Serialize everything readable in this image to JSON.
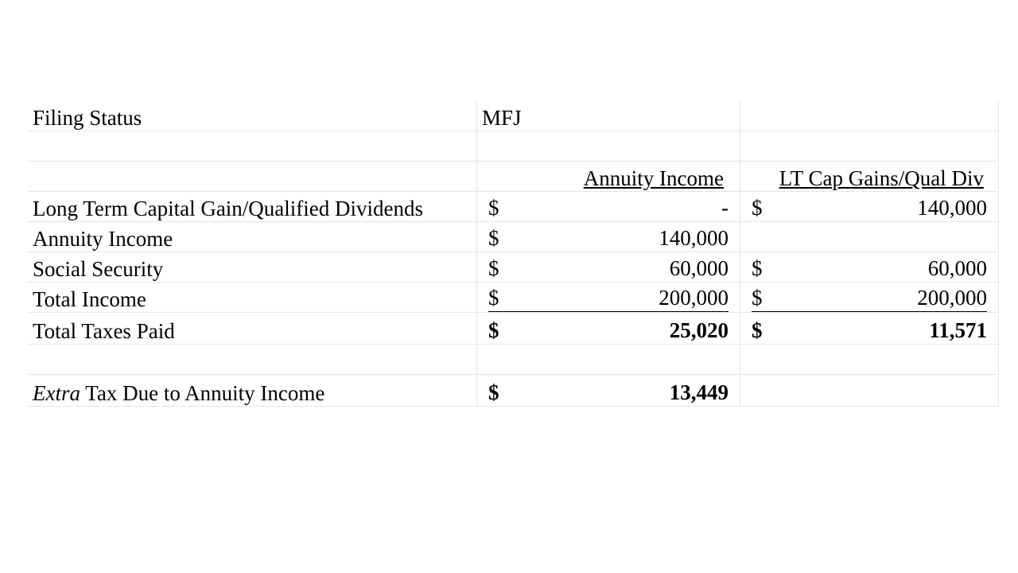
{
  "filing_status": {
    "label": "Filing Status",
    "value": "MFJ"
  },
  "columns": {
    "annuity": "Annuity Income",
    "ltcg": "LT Cap Gains/Qual Div"
  },
  "rows": [
    {
      "label": "Long Term Capital Gain/Qualified Dividends",
      "annuity_cur": "$",
      "annuity": "-",
      "ltcg_cur": "$",
      "ltcg": "140,000"
    },
    {
      "label": "Annuity Income",
      "annuity_cur": "$",
      "annuity": "140,000",
      "ltcg_cur": "",
      "ltcg": ""
    },
    {
      "label": "Social Security",
      "annuity_cur": "$",
      "annuity": "60,000",
      "ltcg_cur": "$",
      "ltcg": "60,000"
    },
    {
      "label": "Total Income",
      "annuity_cur": "$",
      "annuity": "200,000",
      "ltcg_cur": "$",
      "ltcg": "200,000"
    },
    {
      "label": "Total Taxes Paid",
      "annuity_cur": "$",
      "annuity": "25,020",
      "ltcg_cur": "$",
      "ltcg": "11,571"
    }
  ],
  "extra": {
    "label_italic": "Extra",
    "label_rest": " Tax Due to Annuity Income",
    "currency": "$",
    "value": "13,449"
  }
}
